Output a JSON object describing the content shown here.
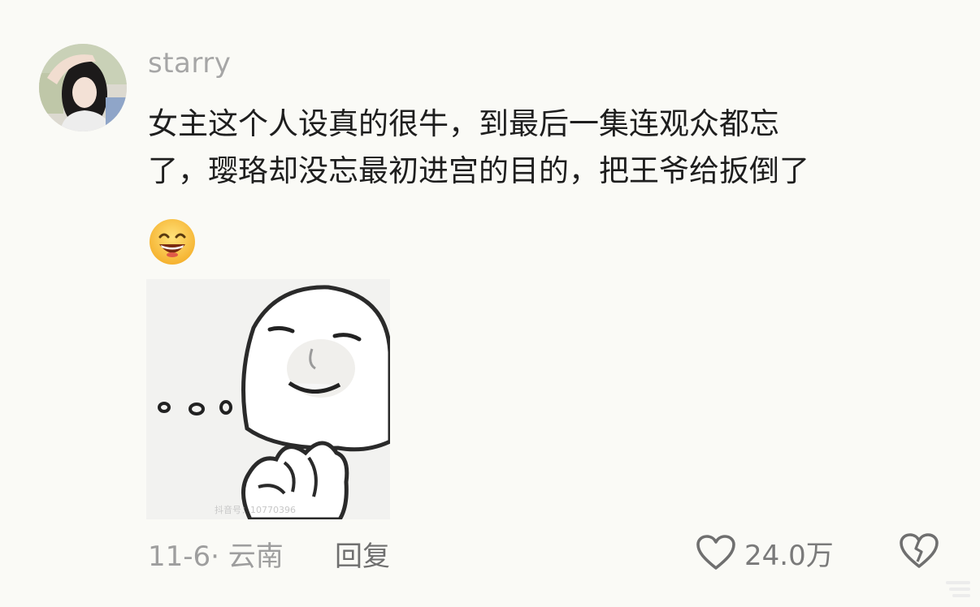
{
  "comment": {
    "username": "starry",
    "text_lines": [
      "女主这个人设真的很牛，到最后一集连观众都忘",
      "了，璎珞却没忘最初进宫的目的，把王爷给扳倒了"
    ],
    "emoji": "grinning-face-emoji",
    "meme_image": "meme-face-thinking",
    "meme_watermark": "抖音号：10770396"
  },
  "footer": {
    "date": "11-6",
    "separator": "·",
    "location": "云南",
    "reply_label": "回复",
    "like_count": "24.0万",
    "like_icon": "heart-outline-icon",
    "dislike_icon": "broken-heart-icon"
  },
  "colors": {
    "background": "#fafaf6",
    "username": "#a6a6a6",
    "text": "#1e1e1e",
    "meta": "#9e9e9e"
  }
}
